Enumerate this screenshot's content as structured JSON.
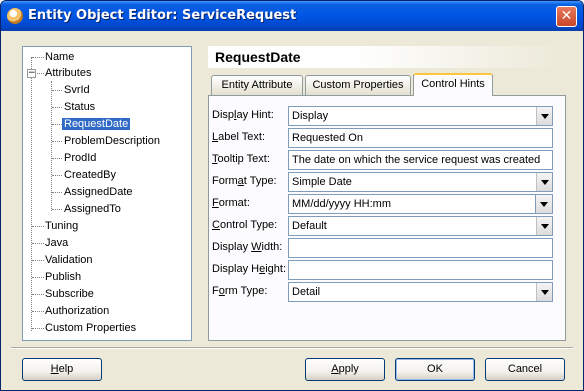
{
  "window": {
    "title": "Entity Object Editor: ServiceRequest"
  },
  "tree": {
    "items": [
      {
        "label": "Name",
        "level": 0
      },
      {
        "label": "Attributes",
        "level": 0,
        "expanded": true
      },
      {
        "label": "SvrId",
        "level": 1
      },
      {
        "label": "Status",
        "level": 1
      },
      {
        "label": "RequestDate",
        "level": 1,
        "selected": true
      },
      {
        "label": "ProblemDescription",
        "level": 1
      },
      {
        "label": "ProdId",
        "level": 1
      },
      {
        "label": "CreatedBy",
        "level": 1
      },
      {
        "label": "AssignedDate",
        "level": 1
      },
      {
        "label": "AssignedTo",
        "level": 1
      },
      {
        "label": "Tuning",
        "level": 0
      },
      {
        "label": "Java",
        "level": 0
      },
      {
        "label": "Validation",
        "level": 0
      },
      {
        "label": "Publish",
        "level": 0
      },
      {
        "label": "Subscribe",
        "level": 0
      },
      {
        "label": "Authorization",
        "level": 0
      },
      {
        "label": "Custom Properties",
        "level": 0
      }
    ]
  },
  "panel": {
    "title": "RequestDate"
  },
  "tabs": [
    {
      "label": "Entity Attribute",
      "active": false
    },
    {
      "label": "Custom Properties",
      "active": false
    },
    {
      "label": "Control Hints",
      "active": true
    }
  ],
  "form": {
    "display_hint": {
      "label_pre": "Disp",
      "label_mn": "l",
      "label_post": "ay Hint:",
      "value": "Display"
    },
    "label_text": {
      "label_pre": "",
      "label_mn": "L",
      "label_post": "abel Text:",
      "value": "Requested On"
    },
    "tooltip_text": {
      "label_pre": "",
      "label_mn": "T",
      "label_post": "ooltip Text:",
      "value": "The date on which the service request was created"
    },
    "format_type": {
      "label_pre": "Form",
      "label_mn": "a",
      "label_post": "t Type:",
      "value": "Simple Date"
    },
    "format": {
      "label_pre": "",
      "label_mn": "F",
      "label_post": "ormat:",
      "value": "MM/dd/yyyy HH:mm"
    },
    "control_type": {
      "label_pre": "",
      "label_mn": "C",
      "label_post": "ontrol Type:",
      "value": "Default"
    },
    "display_width": {
      "label_pre": "Display ",
      "label_mn": "W",
      "label_post": "idth:",
      "value": ""
    },
    "display_height": {
      "label_pre": "Display H",
      "label_mn": "e",
      "label_post": "ight:",
      "value": ""
    },
    "form_type": {
      "label_pre": "F",
      "label_mn": "o",
      "label_post": "rm Type:",
      "value": "Detail"
    }
  },
  "buttons": {
    "help": {
      "pre": "",
      "mn": "H",
      "post": "elp"
    },
    "apply": {
      "pre": "",
      "mn": "A",
      "post": "pply"
    },
    "ok": {
      "label": "OK"
    },
    "cancel": {
      "label": "Cancel"
    }
  }
}
